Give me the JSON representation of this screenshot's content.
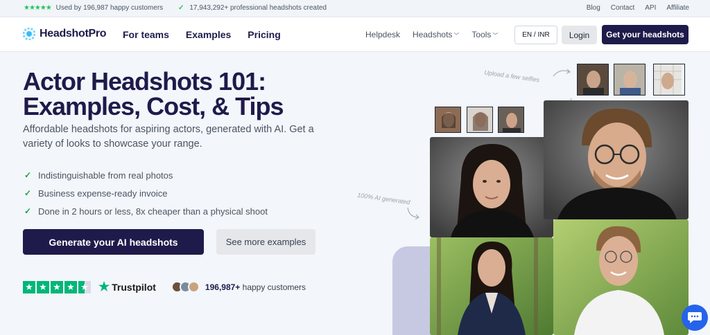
{
  "topbar": {
    "rating_text": "Used by 196,987 happy customers",
    "created_text": "17,943,292+ professional headshots created",
    "links": [
      "Blog",
      "Contact",
      "API",
      "Affiliate"
    ]
  },
  "nav": {
    "logo": "HeadshotPro",
    "links": [
      "For teams",
      "Examples",
      "Pricing"
    ],
    "helpdesk": "Helpdesk",
    "headshots": "Headshots",
    "tools": "Tools",
    "language": "EN / INR",
    "login": "Login",
    "cta": "Get your headshots"
  },
  "hero": {
    "title": "Actor Headshots 101: Examples, Cost, & Tips",
    "subtitle": "Affordable headshots for aspiring actors, generated with AI. Get a variety of looks to showcase your range.",
    "features": [
      "Indistinguishable from real photos",
      "Business expense-ready invoice",
      "Done in 2 hours or less, 8x cheaper than a physical shoot"
    ],
    "primary_button": "Generate your AI headshots",
    "secondary_button": "See more examples"
  },
  "trust": {
    "rating": 4.5,
    "brand": "Trustpilot",
    "customers_count": "196,987+",
    "customers_text": "happy customers"
  },
  "visual": {
    "note_upload": "Upload a few selfies",
    "note_ai": "100% AI generated"
  },
  "colors": {
    "brand_navy": "#1e1b4b",
    "accent_green": "#22c55e",
    "trustpilot_green": "#00b67a",
    "chat_blue": "#2563eb"
  },
  "icons": {
    "logo": "logo-icon",
    "check": "check-icon",
    "star": "star-icon",
    "chat": "chat-icon",
    "chevron": "chevron-down-icon"
  }
}
